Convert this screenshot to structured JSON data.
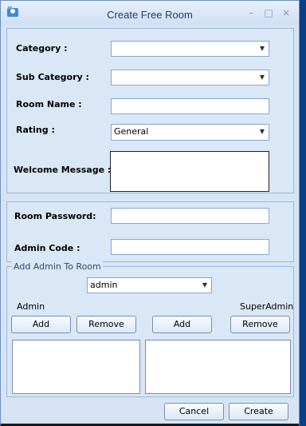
{
  "window": {
    "title": "Create Free Room"
  },
  "form": {
    "category_label": "Category :",
    "subcategory_label": "Sub Category :",
    "room_name_label": "Room Name :",
    "rating_label": "Rating :",
    "rating_value": "General",
    "welcome_label": "Welcome Message :",
    "room_password_label": "Room Password:",
    "admin_code_label": "Admin Code :"
  },
  "admin_group": {
    "legend": "Add Admin To Room",
    "selected_user": "admin",
    "admin_label": "Admin",
    "superadmin_label": "SuperAdmin",
    "add_label": "Add",
    "remove_label": "Remove",
    "add2_label": "Add",
    "remove2_label": "Remove"
  },
  "footer": {
    "cancel_label": "Cancel",
    "create_label": "Create"
  }
}
